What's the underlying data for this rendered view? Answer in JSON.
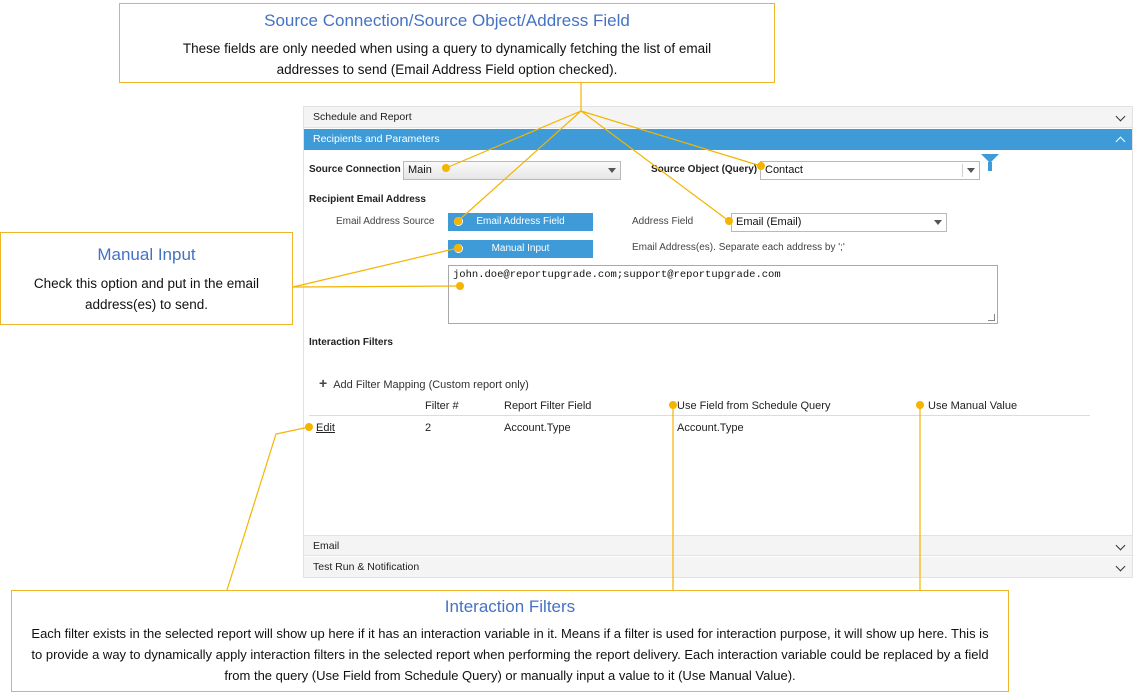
{
  "callouts": {
    "source": {
      "title": "Source Connection/Source Object/Address Field",
      "body": "These fields are only needed when using a query to dynamically fetching the list of email addresses to send (Email Address Field option checked)."
    },
    "manual": {
      "title": "Manual Input",
      "body": "Check this option  and put in the email address(es) to send."
    },
    "filters": {
      "title": "Interaction Filters",
      "body": "Each filter exists in the selected report  will show up here if it has an interaction variable in it. Means if a filter is used for interaction purpose, it will show up here. This is to provide a way to dynamically apply interaction filters in the selected report when performing  the report delivery. Each interaction variable could be replaced by a field from the query (Use Field from Schedule  Query) or manually input a value to it (Use Manual Value)."
    }
  },
  "sections": {
    "schedule": "Schedule and Report",
    "recipients": "Recipients and Parameters",
    "email": "Email",
    "test_run": "Test Run & Notification"
  },
  "recipients": {
    "source_connection_label": "Source Connection",
    "source_connection_value": "Main",
    "source_object_label": "Source Object (Query)",
    "source_object_value": "Contact",
    "recipient_email_heading": "Recipient Email Address",
    "email_address_source_label": "Email Address Source",
    "email_address_field_option": "Email Address Field",
    "manual_input_option": "Manual Input",
    "address_field_label": "Address Field",
    "address_field_value": "Email (Email)",
    "manual_hint": "Email Address(es). Separate each address by ';'",
    "manual_addresses": "john.doe@reportupgrade.com;support@reportupgrade.com"
  },
  "interaction_filters": {
    "heading": "Interaction Filters",
    "add_mapping_label": "Add Filter Mapping (Custom report only)",
    "columns": [
      "Filter #",
      "Report Filter Field",
      "Use Field from Schedule Query",
      "Use Manual Value"
    ],
    "rows": [
      {
        "action": "Edit",
        "filter_no": "2",
        "report_field": "Account.Type",
        "schedule_field": "Account.Type",
        "manual_value": ""
      }
    ]
  },
  "icons": {
    "filter": "filter-funnel-icon",
    "add": "plus-icon",
    "expand": "chevron-down-icon",
    "collapse": "chevron-up-icon"
  },
  "colors": {
    "accent_blue": "#3e9bd8",
    "callout_border": "#f0b429",
    "callout_title": "#4472c4",
    "leader_line": "#f4b400"
  }
}
